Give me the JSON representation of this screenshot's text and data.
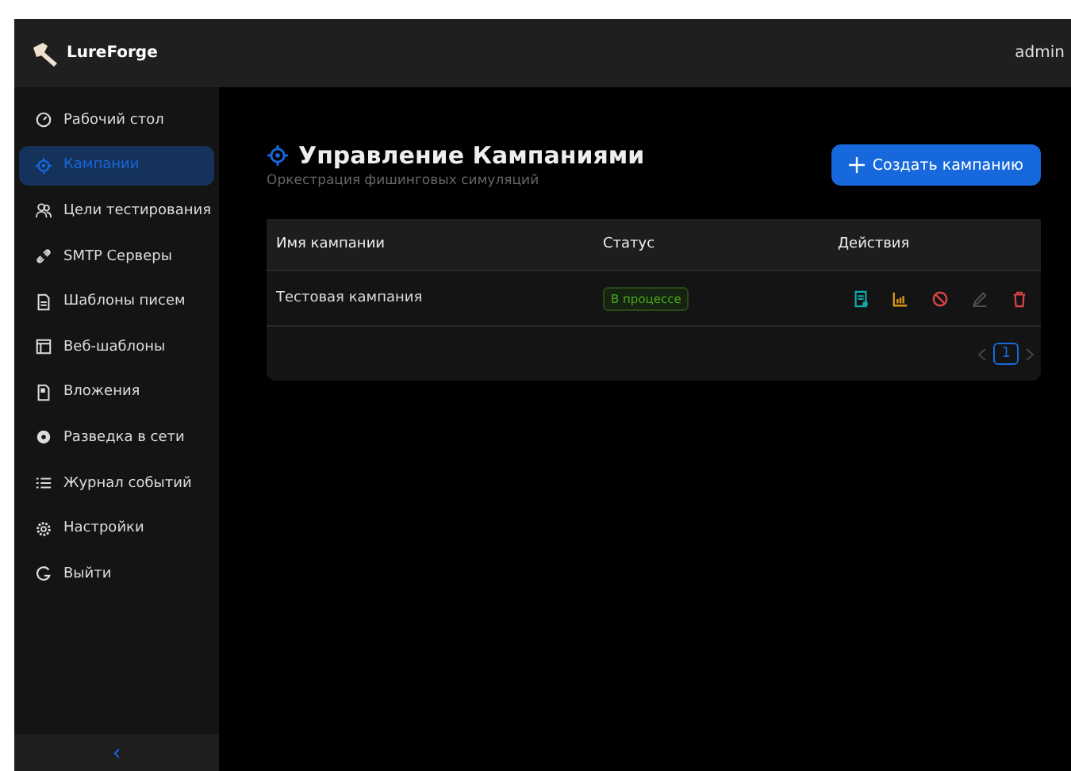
{
  "header": {
    "brand": "LureForge",
    "user": "admin"
  },
  "sidebar": {
    "items": [
      {
        "label": "Рабочий стол",
        "selected": false
      },
      {
        "label": "Кампании",
        "selected": true
      },
      {
        "label": "Цели тестирования",
        "selected": false
      },
      {
        "label": "SMTP Серверы",
        "selected": false
      },
      {
        "label": "Шаблоны писем",
        "selected": false
      },
      {
        "label": "Веб-шаблоны",
        "selected": false
      },
      {
        "label": "Вложения",
        "selected": false
      },
      {
        "label": "Разведка в сети",
        "selected": false
      },
      {
        "label": "Журнал событий",
        "selected": false
      },
      {
        "label": "Настройки",
        "selected": false
      },
      {
        "label": "Выйти",
        "selected": false
      }
    ],
    "collapse": "‹"
  },
  "page": {
    "title": "Управление Кампаниями",
    "subtitle": "Оркестрация фишинговых симуляций",
    "create_button": "Создать кампанию"
  },
  "table": {
    "columns": [
      "Имя кампании",
      "Статус",
      "Действия"
    ],
    "rows": [
      {
        "name": "Тестовая кампания",
        "status": "В процессе"
      }
    ]
  },
  "pagination": {
    "pages": [
      {
        "label": "1",
        "selected": true
      }
    ]
  }
}
